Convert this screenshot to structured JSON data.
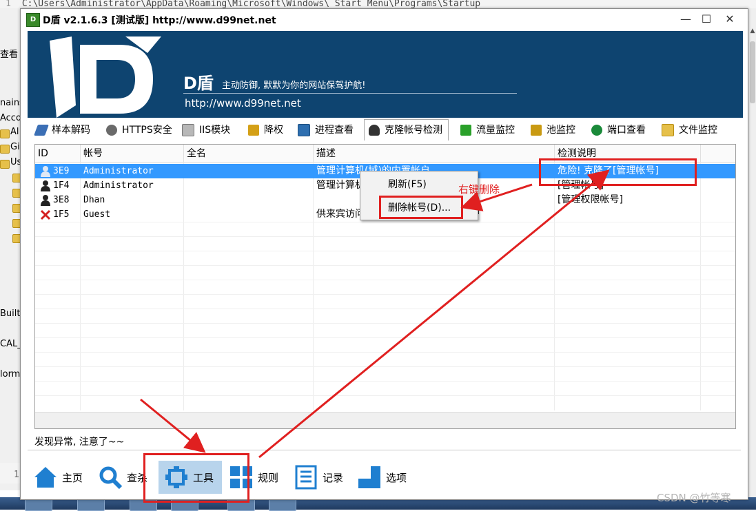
{
  "background": {
    "path_text": "C:\\Users\\Administrator\\AppData\\Roaming\\Microsoft\\Windows\\    Start Menu\\Programs\\Startup",
    "line_numbers": [
      "1",
      "1"
    ],
    "left_fragments": [
      "查看",
      "nains",
      "Acco",
      "Al",
      "Gi",
      "Us",
      "Builti",
      "CAL_",
      "lorm"
    ]
  },
  "window": {
    "title": "D盾 v2.1.6.3 [测试版] http://www.d99net.net",
    "icon_label": "D",
    "controls": {
      "minimize": "—",
      "maximize": "☐",
      "close": "✕"
    }
  },
  "banner": {
    "brand": "D盾",
    "slogan": "主动防御, 默默为你的网站保驾护航!",
    "url": "http://www.d99net.net",
    "color": "#0e4470"
  },
  "tabs": [
    {
      "label": "样本解码",
      "icon": "feather-icon",
      "color": "#3b6fb5"
    },
    {
      "label": "HTTPS安全",
      "icon": "gear-icon",
      "color": "#6a6a6a"
    },
    {
      "label": "IIS模块",
      "icon": "module-icon",
      "color": "#8a8a8a"
    },
    {
      "label": "降权",
      "icon": "badge-icon",
      "color": "#d4a017"
    },
    {
      "label": "进程查看",
      "icon": "window-icon",
      "color": "#2e6fb0"
    },
    {
      "label": "克隆帐号检测",
      "icon": "user-icon",
      "color": "#333333",
      "active": true
    },
    {
      "label": "流量监控",
      "icon": "chart-icon",
      "color": "#2aa02a"
    },
    {
      "label": "池监控",
      "icon": "pool-icon",
      "color": "#c99a12"
    },
    {
      "label": "端口查看",
      "icon": "globe-icon",
      "color": "#1a8a3a"
    },
    {
      "label": "文件监控",
      "icon": "folder-icon",
      "color": "#e6c04a"
    }
  ],
  "table": {
    "columns": [
      "ID",
      "帐号",
      "全名",
      "描述",
      "检测说明"
    ],
    "rows": [
      {
        "id": "3E9",
        "account": "Administrator",
        "fullname": "",
        "desc": "管理计算机(域)的内置帐户",
        "note": "危险! 克隆了[管理帐号]",
        "selected": true,
        "icon": "user-icon"
      },
      {
        "id": "1F4",
        "account": "Administrator",
        "fullname": "",
        "desc": "管理计算机",
        "note": "[管理帐号]",
        "selected": false,
        "icon": "user-icon"
      },
      {
        "id": "3E8",
        "account": "Dhan",
        "fullname": "",
        "desc": "",
        "note": "[管理权限帐号]",
        "selected": false,
        "icon": "user-icon"
      },
      {
        "id": "1F5",
        "account": "Guest",
        "fullname": "",
        "desc": "供来宾访问计算机或访问域的内置帐户",
        "note": "",
        "selected": false,
        "icon": "disabled-user-icon"
      }
    ]
  },
  "context_menu": {
    "items": [
      "刷新(F5)",
      "删除帐号(D)..."
    ]
  },
  "status_text": "发现异常, 注意了~~",
  "bottom_nav": [
    {
      "label": "主页",
      "icon": "home-icon"
    },
    {
      "label": "查杀",
      "icon": "magnifier-icon"
    },
    {
      "label": "工具",
      "icon": "tools-icon",
      "active": true
    },
    {
      "label": "规则",
      "icon": "grid-icon"
    },
    {
      "label": "记录",
      "icon": "list-icon"
    },
    {
      "label": "选项",
      "icon": "options-icon"
    }
  ],
  "annotations": {
    "right_click_delete": "右键删除",
    "color": "#e02020"
  },
  "watermark": "CSDN @竹等寒"
}
